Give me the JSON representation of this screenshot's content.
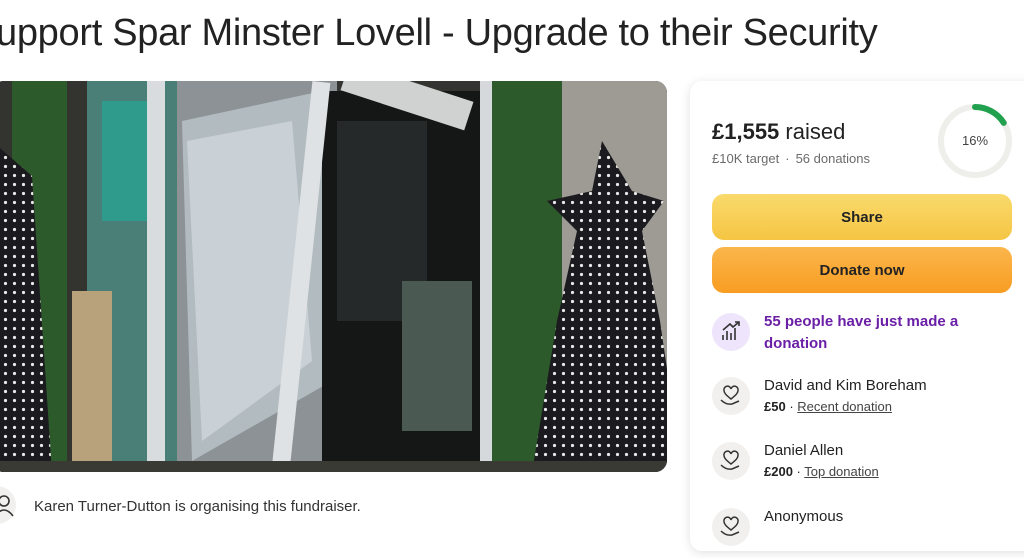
{
  "page": {
    "title": "upport Spar Minster Lovell - Upgrade to their Security"
  },
  "colors": {
    "accent_green": "#21a04e",
    "share_button": "#f7cf55",
    "donate_button": "#f9a92f",
    "trend_text": "#6a1fa6"
  },
  "organiser": {
    "text": "Karen Turner-Dutton is organising this fundraiser.",
    "icon": "user-icon"
  },
  "donation_panel": {
    "raised_amount": "£1,555",
    "raised_word": "raised",
    "target": "£10K target",
    "separator": "·",
    "donation_count": "56 donations",
    "progress_label": "16%",
    "progress_fraction": 0.16,
    "share_label": "Share",
    "donate_label": "Donate now",
    "trend_text": "55 people have just made a donation",
    "donors": [
      {
        "name": "David and Kim Boreham",
        "amount": "£50",
        "tag": "Recent donation",
        "icon": "heart-hand-icon"
      },
      {
        "name": "Daniel Allen",
        "amount": "£200",
        "tag": "Top donation",
        "icon": "heart-hand-icon"
      },
      {
        "name": "Anonymous",
        "amount": "",
        "tag": "",
        "icon": "heart-hand-icon"
      }
    ]
  }
}
